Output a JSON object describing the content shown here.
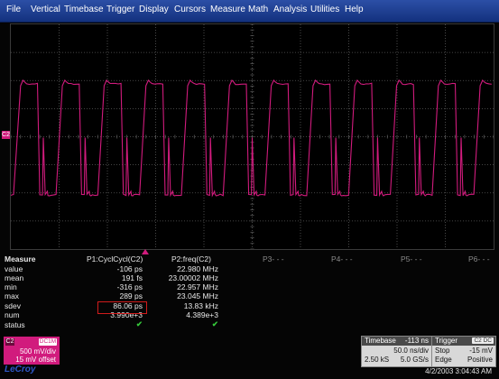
{
  "menu": [
    "File",
    "Vertical",
    "Timebase",
    "Trigger",
    "Display",
    "Cursors",
    "Measure",
    "Math",
    "Analysis",
    "Utilities",
    "Help"
  ],
  "channel_marker": "C2",
  "measure": {
    "header": "Measure",
    "rows": [
      "value",
      "mean",
      "min",
      "max",
      "sdev",
      "num",
      "status"
    ],
    "p1": {
      "title": "P1:CyclCycl(C2)",
      "values": [
        "-106 ps",
        "191 fs",
        "-316 ps",
        "289 ps",
        "86.06 ps",
        "3.990e+3"
      ]
    },
    "p2": {
      "title": "P2:freq(C2)",
      "values": [
        "22.980 MHz",
        "23.00002 MHz",
        "22.957 MHz",
        "23.045 MHz",
        "13.83 kHz",
        "4.389e+3"
      ]
    },
    "p_empty": [
      "P3- - -",
      "P4- - -",
      "P5- - -",
      "P6- - -"
    ]
  },
  "channel_box": {
    "tag": "C2",
    "coupling": "DC1M",
    "scale": "500 mV/div",
    "offset": "15 mV offset"
  },
  "brand": "LeCroy",
  "timebase": {
    "title": "Timebase",
    "delay": "-113 ns",
    "rate": "50.0 ns/div",
    "samples": "2.50 kS",
    "srate": "5.0 GS/s"
  },
  "trigger": {
    "title": "Trigger",
    "badge": "C2 DC",
    "mode": "Stop",
    "level": "-15 mV",
    "type": "Edge",
    "slope": "Positive"
  },
  "datetime": "4/2/2003 3:04:43 AM",
  "colors": {
    "trace": "#d11b7d",
    "menubar": "#1f3f92",
    "grid": "#5a5a5a"
  }
}
